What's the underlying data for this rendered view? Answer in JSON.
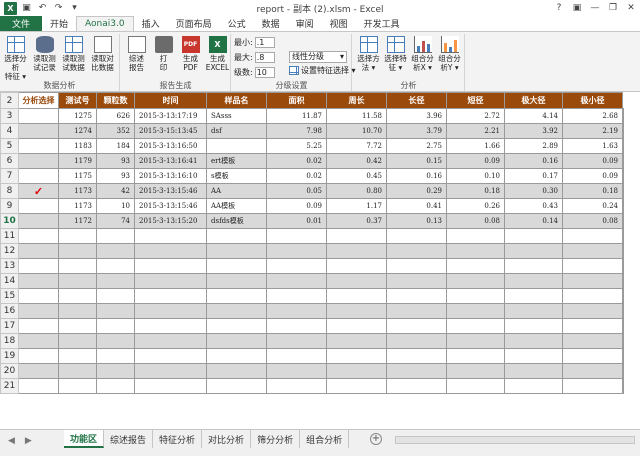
{
  "app": {
    "title": "report - 副本 (2).xlsm - Excel",
    "logo": "X",
    "win_controls": [
      "?",
      "▣",
      "—",
      "❐",
      "✕"
    ]
  },
  "tabs": [
    "文件",
    "开始",
    "Aonai3.0",
    "插入",
    "页面布局",
    "公式",
    "数据",
    "审阅",
    "视图",
    "开发工具"
  ],
  "active_tab": "Aonai3.0",
  "ribbon": {
    "groups": [
      "数据分析",
      "报告生成",
      "分级设置",
      "分析"
    ],
    "data_analysis": [
      {
        "line1": "选择分析",
        "line2": "特征 ▾"
      },
      {
        "line1": "读取测",
        "line2": "试记录"
      },
      {
        "line1": "读取测",
        "line2": "试数据"
      },
      {
        "line1": "读取对",
        "line2": "比数据"
      }
    ],
    "report": [
      {
        "line1": "综述",
        "line2": "报告"
      },
      {
        "line1": "打",
        "line2": "印"
      },
      {
        "line1": "生成",
        "line2": "PDF"
      },
      {
        "line1": "生成",
        "line2": "EXCEL"
      }
    ],
    "grading": {
      "min_label": "最小:",
      "min_value": ".1",
      "max_label": "最大:",
      "max_value": ".8",
      "levels_label": "级数:",
      "levels_value": "10",
      "mode": "线性分级",
      "select_feature": "设置特征选择 ▾"
    },
    "analysis": [
      {
        "line1": "选择方",
        "line2": "法 ▾"
      },
      {
        "line1": "选择特",
        "line2": "征 ▾"
      },
      {
        "line1": "组合分",
        "line2": "析X ▾"
      },
      {
        "line1": "组合分",
        "line2": "析Y ▾"
      }
    ]
  },
  "sheet": {
    "headers": [
      "分析选择",
      "测试号",
      "颗粒数",
      "时间",
      "样品名",
      "面积",
      "周长",
      "长径",
      "短径",
      "极大径",
      "极小径"
    ],
    "rows": [
      {
        "num": "3",
        "cells": [
          "",
          "1275",
          "626",
          "2015-3-13:17:19",
          "SAsss",
          "11.87",
          "11.58",
          "3.96",
          "2.72",
          "4.14",
          "2.68"
        ]
      },
      {
        "num": "4",
        "cells": [
          "",
          "1274",
          "352",
          "2015-3-15:13:45",
          "dsf",
          "7.98",
          "10.70",
          "3.79",
          "2.21",
          "3.92",
          "2.19"
        ]
      },
      {
        "num": "5",
        "cells": [
          "",
          "1183",
          "184",
          "2015-3-13:16:50",
          "",
          "5.25",
          "7.72",
          "2.75",
          "1.66",
          "2.89",
          "1.63"
        ]
      },
      {
        "num": "6",
        "cells": [
          "",
          "1179",
          "93",
          "2015-3-13:16:41",
          "ert模板",
          "0.02",
          "0.42",
          "0.15",
          "0.09",
          "0.16",
          "0.09"
        ]
      },
      {
        "num": "7",
        "cells": [
          "",
          "1175",
          "93",
          "2015-3-13:16:10",
          "s模板",
          "0.02",
          "0.45",
          "0.16",
          "0.10",
          "0.17",
          "0.09"
        ]
      },
      {
        "num": "8",
        "cells": [
          "✓",
          "1173",
          "42",
          "2015-3-13:15:46",
          "AA",
          "0.05",
          "0.80",
          "0.29",
          "0.18",
          "0.30",
          "0.18"
        ]
      },
      {
        "num": "9",
        "cells": [
          "",
          "1173",
          "10",
          "2015-3-13:15:46",
          "AA模板",
          "0.09",
          "1.17",
          "0.41",
          "0.26",
          "0.43",
          "0.24"
        ]
      },
      {
        "num": "10",
        "cells": [
          "",
          "1172",
          "74",
          "2015-3-13:15:20",
          "dsfds模板",
          "0.01",
          "0.37",
          "0.13",
          "0.08",
          "0.14",
          "0.08"
        ]
      }
    ],
    "empty_rows": [
      "11",
      "12",
      "13",
      "14",
      "15",
      "16",
      "17",
      "18",
      "19",
      "20",
      "21"
    ],
    "header_row_num": "2",
    "selected_row": "10"
  },
  "sheet_tabs": [
    "功能区",
    "综述报告",
    "特征分析",
    "对比分析",
    "筛分分析",
    "组合分析"
  ],
  "active_sheet": "功能区",
  "colors": {
    "excel_green": "#217346",
    "header_brown": "#9a4a0b",
    "shade_gray": "#d9d9d9"
  },
  "icons": [
    "save-icon",
    "undo-icon",
    "redo-icon",
    "grid-icon",
    "database-icon",
    "document-icon",
    "print-icon",
    "pdf-icon",
    "excel-icon",
    "chart-icon",
    "check-icon",
    "add-sheet-icon"
  ]
}
